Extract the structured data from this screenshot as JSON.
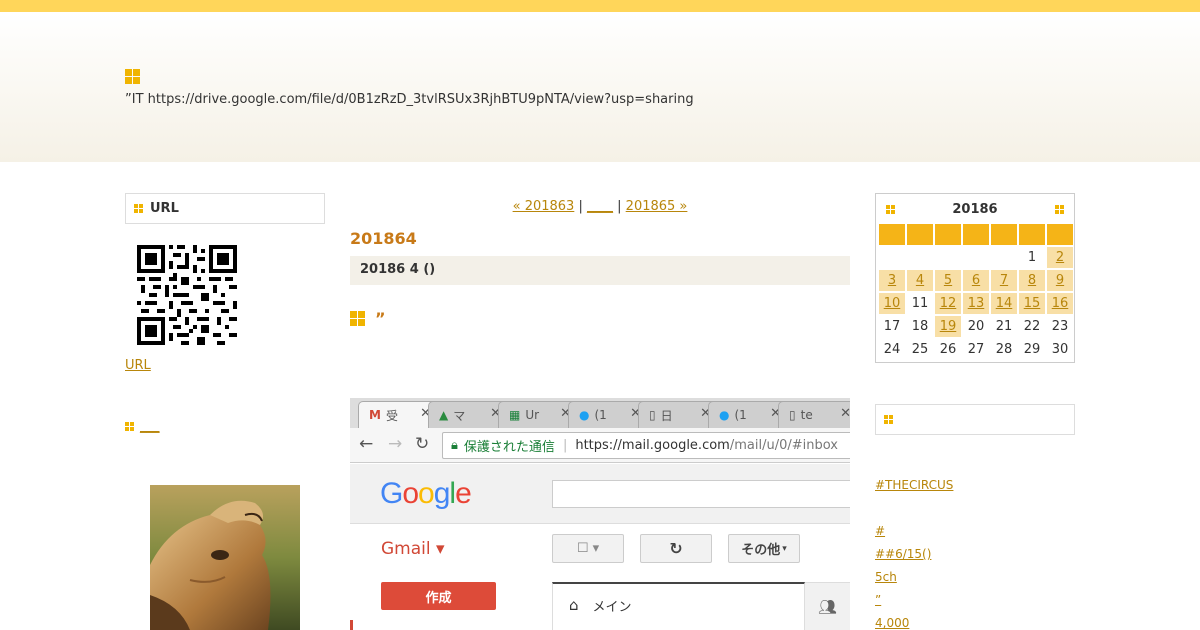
{
  "header": {
    "description": "”IT  https://drive.google.com/file/d/0B1zRzD_3tvlRSUx3RjhBTU9pNTA/view?usp=sharing"
  },
  "sidebar_left": {
    "url_heading": "URL",
    "qr_link": "URL",
    "section_link": "___"
  },
  "main": {
    "pager": {
      "prev": "« 201863",
      "sep1": "|",
      "middle": "____",
      "sep2": "|",
      "next": "201865 »"
    },
    "month_title": "201864",
    "date_bar": "20186 4 ()",
    "post_title": "”"
  },
  "screenshot": {
    "tabs": [
      "受",
      "マ",
      "Ur",
      "(1",
      "日",
      "(1",
      "te"
    ],
    "secure_label": "保護された通信",
    "url_host": "https://mail.google.com",
    "url_path": "/mail/u/0/#inbox",
    "google_logo": "Google",
    "gmail_label": "Gmail ▾",
    "more_button": "その他",
    "compose_button": "作成",
    "inbox_tab": "メイン"
  },
  "calendar": {
    "title": "20186",
    "weeks": [
      [
        "",
        "",
        "",
        "",
        "",
        "1",
        "2"
      ],
      [
        "3",
        "4",
        "5",
        "6",
        "7",
        "8",
        "9"
      ],
      [
        "10",
        "11",
        "12",
        "13",
        "14",
        "15",
        "16"
      ],
      [
        "17",
        "18",
        "19",
        "20",
        "21",
        "22",
        "23"
      ],
      [
        "24",
        "25",
        "26",
        "27",
        "28",
        "29",
        "30"
      ]
    ],
    "linked_days": [
      "2",
      "3",
      "4",
      "5",
      "6",
      "7",
      "8",
      "9",
      "10",
      "12",
      "13",
      "14",
      "15",
      "16",
      "19"
    ]
  },
  "sidebar_right": {
    "links": [
      "",
      "#THECIRCUS",
      "",
      "#",
      "##6/15()",
      "5ch",
      "”",
      "4,000"
    ]
  },
  "colors": {
    "accent": "#f0b400",
    "link": "#b8860b",
    "title": "#c87a18",
    "topbar": "#ffd65a"
  }
}
